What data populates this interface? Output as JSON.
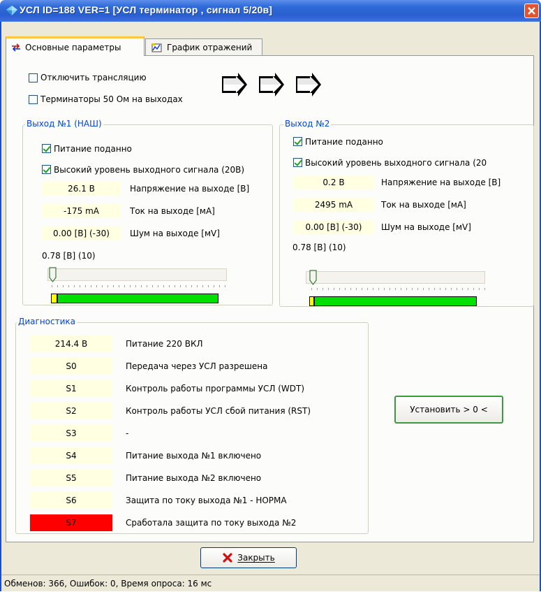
{
  "window": {
    "title": "УСЛ ID=188 VER=1 [УСЛ терминатор , сигнал 5/20в]",
    "title_icon": "diamond-icon",
    "close_icon": "close-icon"
  },
  "tabs": [
    {
      "label": "Основные параметры",
      "icon": "arrows-icon",
      "active": true
    },
    {
      "label": "График отражений",
      "icon": "chart-icon",
      "active": false
    }
  ],
  "options": {
    "disable_translation": {
      "label": "Отключить трансляцию",
      "checked": false
    },
    "terminators_50": {
      "label": "Терминаторы 50 Ом на выходах",
      "checked": false
    }
  },
  "outputs": [
    {
      "title": "Выход №1 (НАШ)",
      "power": {
        "label": "Питание поданно",
        "checked": true
      },
      "high_level": {
        "label": "Высокий уровень выходного сигнала (20В)",
        "checked": true
      },
      "rows": [
        {
          "value": "26.1 В",
          "label": "Напряжение на выходе  [В]"
        },
        {
          "value": "-175 mA",
          "label": "Ток на выходе  [мА]"
        },
        {
          "value": "0.00 [В] (-30)",
          "label": "Шум на выходе  [мV]"
        }
      ],
      "level_text": "0.78 [В] (10)",
      "slider_position": 0.0,
      "bar_level": 0.03
    },
    {
      "title": "Выход №2",
      "power": {
        "label": "Питание поданно",
        "checked": true
      },
      "high_level": {
        "label": "Высокий уровень выходного сигнала (20",
        "checked": true
      },
      "rows": [
        {
          "value": "0.2 В",
          "label": "Напряжение на выходе  [В]"
        },
        {
          "value": "2495 mA",
          "label": "Ток на выходе  [мА]"
        },
        {
          "value": "0.00 [В] (-30)",
          "label": "Шум на выходе  [мV]"
        }
      ],
      "level_text": "0.78 [В] (10)",
      "slider_position": 0.0,
      "bar_level": 0.02
    }
  ],
  "diagnostics": {
    "title": "Диагностика",
    "rows": [
      {
        "code": "214.4 В",
        "label": "Питание 220 ВКЛ",
        "color": "#ffffe1"
      },
      {
        "code": "S0",
        "label": "Передача через УСЛ разрешена",
        "color": "#ffffe1"
      },
      {
        "code": "S1",
        "label": "Контроль работы программы УСЛ (WDT)",
        "color": "#ffffe1"
      },
      {
        "code": "S2",
        "label": "Контроль работы  УСЛ сбой питания (RST)",
        "color": "#ffffe1"
      },
      {
        "code": "S3",
        "label": "-",
        "color": "#ffffe1"
      },
      {
        "code": "S4",
        "label": "Питание выхода №1 включено",
        "color": "#ffffe1"
      },
      {
        "code": "S5",
        "label": "Питание выхода №2 включено",
        "color": "#ffffe1"
      },
      {
        "code": "S6",
        "label": "Защита по току выхода №1 - НОРМА",
        "color": "#ffffe1"
      },
      {
        "code": "S7",
        "label": "Сработала защита по току выхода №2",
        "color": "#ff0000"
      }
    ],
    "set_button": "Установить > 0 <"
  },
  "footer": {
    "close_button": "Закрыть",
    "close_icon": "x-icon",
    "status": "Обменов: 366, Ошибок: 0, Время опроса: 16 мс"
  }
}
